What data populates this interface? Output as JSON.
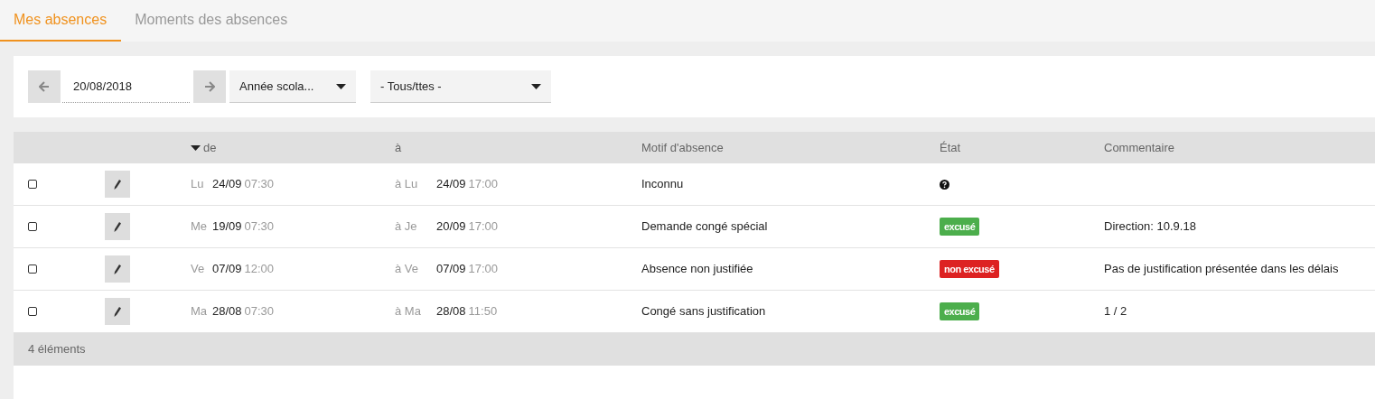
{
  "tabs": [
    {
      "label": "Mes absences",
      "selected": true
    },
    {
      "label": "Moments des absences",
      "selected": false
    }
  ],
  "filters": {
    "date": "20/08/2018",
    "period": "Année scola...",
    "category": "- Tous/ttes -"
  },
  "table": {
    "columns": [
      {
        "label": "de",
        "sorted": true
      },
      {
        "label": "à",
        "sorted": false
      },
      {
        "label": "Motif d'absence",
        "sorted": false
      },
      {
        "label": "État",
        "sorted": false
      },
      {
        "label": "Commentaire",
        "sorted": false
      }
    ],
    "rows": [
      {
        "checked": false,
        "from_day": "Lu",
        "from_date": "24/09",
        "from_time": "07:30",
        "to_day": "à Lu",
        "to_date": "24/09",
        "to_time": "17:00",
        "reason": "Inconnu",
        "status": {
          "kind": "unknown"
        }
      },
      {
        "checked": false,
        "from_day": "Me",
        "from_date": "19/09",
        "from_time": "07:30",
        "to_day": "à Je",
        "to_date": "20/09",
        "to_time": "17:00",
        "reason": "Demande congé spécial",
        "status": {
          "kind": "excused",
          "label": "excusé"
        },
        "comment": "Direction: 10.9.18"
      },
      {
        "checked": false,
        "from_day": "Ve",
        "from_date": "07/09",
        "from_time": "12:00",
        "to_day": "à Ve",
        "to_date": "07/09",
        "to_time": "17:00",
        "reason": "Absence non justifiée",
        "status": {
          "kind": "unexcused",
          "label": "non excusé"
        },
        "comment": "Pas de justification présentée dans les délais"
      },
      {
        "checked": false,
        "from_day": "Ma",
        "from_date": "28/08",
        "from_time": "07:30",
        "to_day": "à Ma",
        "to_date": "28/08",
        "to_time": "11:50",
        "reason": "Congé sans justification",
        "status": {
          "kind": "excused",
          "label": "excusé"
        },
        "comment": "1 / 2"
      }
    ],
    "footer": "4 éléments"
  }
}
